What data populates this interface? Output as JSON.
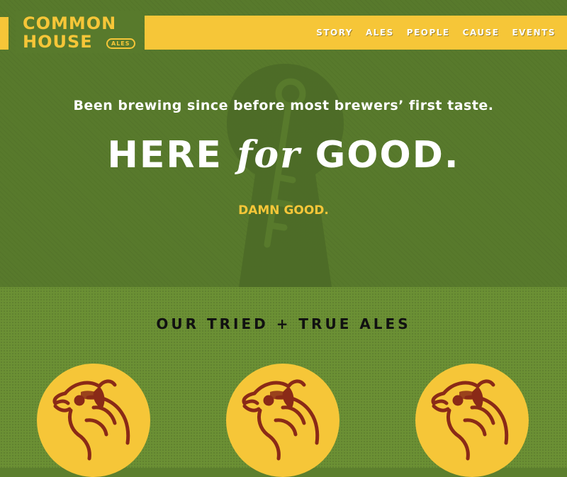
{
  "brand": {
    "line1": "COMMON",
    "line2": "HOUSE",
    "badge": "ALES"
  },
  "nav": {
    "items": [
      "STORY",
      "ALES",
      "PEOPLE",
      "CAUSE",
      "EVENTS"
    ]
  },
  "hero": {
    "tagline": "Been brewing since before most brewers’ first taste.",
    "headline_part1": "HERE",
    "headline_part2": "for",
    "headline_part3": "GOOD.",
    "subhead": "DAMN GOOD."
  },
  "ales": {
    "title": "OUR TRIED + TRUE ALES",
    "items": [
      {
        "icon": "rooster-icon"
      },
      {
        "icon": "rooster-icon"
      },
      {
        "icon": "rooster-icon"
      }
    ]
  },
  "colors": {
    "brand_yellow": "#f6c638",
    "hero_green": "#587a2c",
    "ales_green": "#6b9034",
    "rooster_red": "#8a2a17"
  }
}
